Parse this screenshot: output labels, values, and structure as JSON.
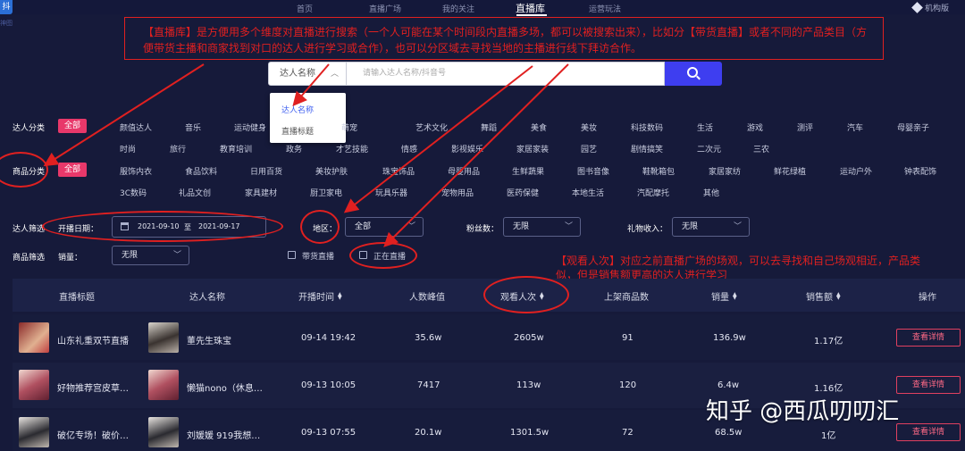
{
  "top_nav": {
    "logo_text": "抖",
    "logo_sub": "神图",
    "items": [
      {
        "label": "首页"
      },
      {
        "label": "直播广场"
      },
      {
        "label": "我的关注"
      },
      {
        "label": "直播库"
      },
      {
        "label": "运营玩法"
      }
    ],
    "active_index": 3,
    "version_label": "机构版"
  },
  "annotations": {
    "note1": "【直播库】是方便用多个维度对直播进行搜索（一个人可能在某个时间段内直播多场，都可以被搜索出来），比如分【带货直播】或者不同的产品类目（方便带货主播和商家找到对口的达人进行学习或合作），也可以分区域去寻找当地的主播进行线下拜访合作。",
    "note2": "【观看人次】对应之前直播广场的场观，可以去寻找和自己场观相近，产品类似，但是销售额更高的达人进行学习",
    "color": "#e02020"
  },
  "search": {
    "type_selected": "达人名称",
    "placeholder": "请输入达人名称/抖音号",
    "options": [
      "达人名称",
      "直播标题"
    ]
  },
  "filters": {
    "talent_category": {
      "label": "达人分类",
      "all": "全部",
      "row1": [
        "颜值达人",
        "音乐",
        "运动健身",
        "萌宠",
        "艺术文化",
        "舞蹈",
        "美食",
        "美妆",
        "科技数码",
        "生活",
        "游戏",
        "测评",
        "汽车",
        "母婴亲子"
      ],
      "row2": [
        "时尚",
        "旅行",
        "教育培训",
        "政务",
        "才艺技能",
        "情感",
        "影视娱乐",
        "家居家装",
        "园艺",
        "剧情搞笑",
        "二次元",
        "三农"
      ]
    },
    "product_category": {
      "label": "商品分类",
      "all": "全部",
      "row1": [
        "服饰内衣",
        "食品饮料",
        "日用百货",
        "美妆护肤",
        "珠宝饰品",
        "母婴用品",
        "生鲜蔬果",
        "图书音像",
        "鞋靴箱包",
        "家居家纺",
        "鲜花绿植",
        "运动户外",
        "钟表配饰"
      ],
      "row2": [
        "3C数码",
        "礼品文创",
        "家具建材",
        "厨卫家电",
        "玩具乐器",
        "宠物用品",
        "医药保健",
        "本地生活",
        "汽配摩托",
        "其他"
      ]
    },
    "talent_filter": {
      "label": "达人筛选",
      "date_label": "开播日期：",
      "date_start": "2021-09-10",
      "date_sep": "至",
      "date_end": "2021-09-17",
      "region_label": "地区：",
      "region_value": "全部",
      "fans_label": "粉丝数：",
      "fans_value": "无限",
      "gift_label": "礼物收入：",
      "gift_value": "无限"
    },
    "product_filter": {
      "label": "商品筛选",
      "sales_label": "销量：",
      "sales_value": "无限",
      "goods_live": "带货直播",
      "is_live": "正在直播"
    }
  },
  "table": {
    "columns": [
      "直播标题",
      "达人名称",
      "开播时间",
      "人数峰值",
      "观看人次",
      "上架商品数",
      "销量",
      "销售额",
      "操作"
    ],
    "action_label": "查看详情",
    "rows": [
      {
        "title": "山东礼重双节直播",
        "talent": "董先生珠宝",
        "start": "09-14 19:42",
        "peak": "35.6w",
        "views": "2605w",
        "items": "91",
        "sales": "136.9w",
        "revenue": "1.17亿"
      },
      {
        "title": "好物推荐宫皮草…",
        "talent": "懒猫nono（休息…",
        "start": "09-13 10:05",
        "peak": "7417",
        "views": "113w",
        "items": "120",
        "sales": "6.4w",
        "revenue": "1.16亿"
      },
      {
        "title": "破亿专场！破价…",
        "talent": "刘媛媛 919我想…",
        "start": "09-13 07:55",
        "peak": "20.1w",
        "views": "1301.5w",
        "items": "72",
        "sales": "68.5w",
        "revenue": "1亿"
      }
    ]
  },
  "watermark": "知乎 @西瓜叨叨汇"
}
